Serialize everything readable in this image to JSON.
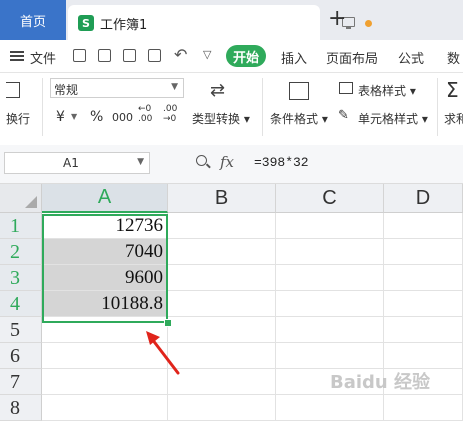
{
  "tabs": {
    "home": "首页",
    "document": "工作簿1",
    "doc_icon": "S"
  },
  "menu": {
    "file": "文件",
    "start": "开始",
    "items": [
      "插入",
      "页面布局",
      "公式",
      "数"
    ]
  },
  "ribbon": {
    "wrap": "换行",
    "number_format": "常规",
    "currency": "¥",
    "percent": "%",
    "thousand": "000",
    "inc_decimal": ".00",
    "dec_decimal": ".00",
    "type_convert": "类型转换",
    "cond_format": "条件格式",
    "table_style": "表格样式",
    "cell_style": "单元格样式",
    "sum": "求和"
  },
  "formula_bar": {
    "cell_ref": "A1",
    "fx": "fx",
    "formula": "=398*32"
  },
  "grid": {
    "columns": [
      "A",
      "B",
      "C",
      "D"
    ],
    "rows": [
      "1",
      "2",
      "3",
      "4",
      "5",
      "6",
      "7",
      "8"
    ],
    "values": [
      "12736",
      "7040",
      "9600",
      "10188.8"
    ]
  },
  "colors": {
    "accent": "#2faa5b",
    "tab_blue": "#3a74c9",
    "arrow": "#e0241b"
  },
  "watermark": "Baidu 经验"
}
